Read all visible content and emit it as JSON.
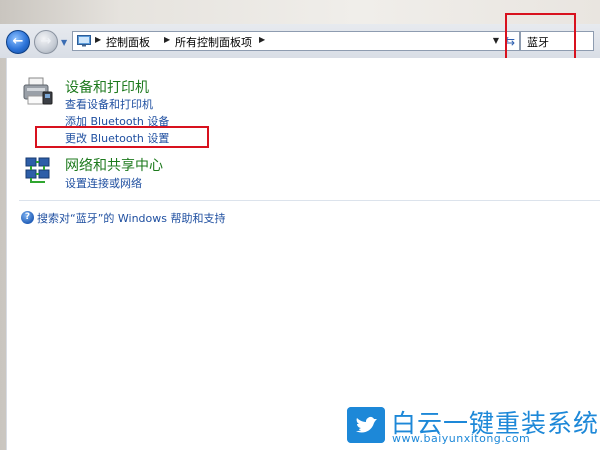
{
  "address_bar": {
    "breadcrumbs": [
      "控制面板",
      "所有控制面板项"
    ]
  },
  "search": {
    "value": "蓝牙"
  },
  "results": [
    {
      "title": "设备和打印机",
      "icon": "printer-icon",
      "links": [
        "查看设备和打印机",
        "添加 Bluetooth 设备",
        "更改 Bluetooth 设置"
      ]
    },
    {
      "title": "网络和共享中心",
      "icon": "network-icon",
      "links": [
        "设置连接或网络"
      ]
    }
  ],
  "help": {
    "label": "搜索对“蓝牙”的 Windows 帮助和支持"
  },
  "watermark": {
    "title": "白云一键重装系统",
    "url": "www.baiyunxitong.com"
  },
  "colors": {
    "highlight": "#d8111e",
    "category_title": "#1e7a1e",
    "link": "#1f4fa0",
    "watermark": "#1d88d8"
  }
}
